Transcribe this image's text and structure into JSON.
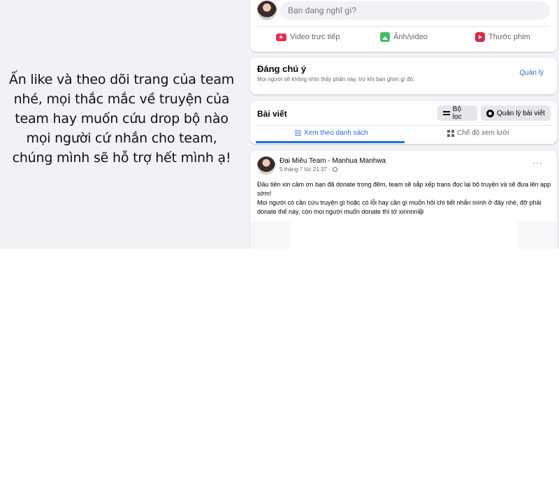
{
  "banner": {
    "message": "Ấn like và theo dõi trang của team nhé, mọi thắc mắc về truyện của team hay muốn cứu drop bộ nào mọi người cứ nhắn cho team, chúng mình sẽ hỗ trợ hết mình ạ!"
  },
  "composer": {
    "placeholder": "Bạn đang nghĩ gì?",
    "actions": {
      "live_video": "Video trực tiếp",
      "photo_video": "Ảnh/video",
      "reel": "Thước phim"
    },
    "icons": {
      "live_video": "live-video-icon",
      "photo_video": "photo-icon",
      "reel": "reel-icon"
    }
  },
  "notice": {
    "title": "Đáng chú ý",
    "subtitle": "Mọi người sẽ không nhìn thấy phần này, trừ khi bạn ghim gì đó.",
    "manage_label": "Quản lý"
  },
  "posts": {
    "title": "Bài viết",
    "filter_label": "Bộ lọc",
    "manage_label": "Quản lý bài viết",
    "tabs": {
      "list_view": "Xem theo danh sách",
      "grid_view": "Chế độ xem lưới"
    },
    "active_tab": "list_view"
  },
  "post": {
    "author": "Đại Miêu Team - Manhua Manhwa",
    "timestamp": "5 tháng 7 lúc 21:37 ·",
    "body_line1": "Đầu tiên xin cảm ơn bạn đã donate trong đêm, team sẽ sắp xếp trans đọc lại bộ truyện và sẽ đưa lên app sớm!",
    "body_line2": "Mọi người có cần cứu truyện gì hoặc có lỗi hay cần gì muốn hỏi chi tiết nhắn mình ở đây nhé, đỡ phải donate thế này, còn mọi người muốn donate thì tớ xinnnn😆",
    "more_label": "···"
  },
  "colors": {
    "accent": "#216fdb",
    "background": "#f0f2f5",
    "card": "#ffffff",
    "secondary_text": "#65676b",
    "live_red": "#f02849",
    "photo_green": "#45bd62",
    "reel_pink": "#e42645"
  }
}
